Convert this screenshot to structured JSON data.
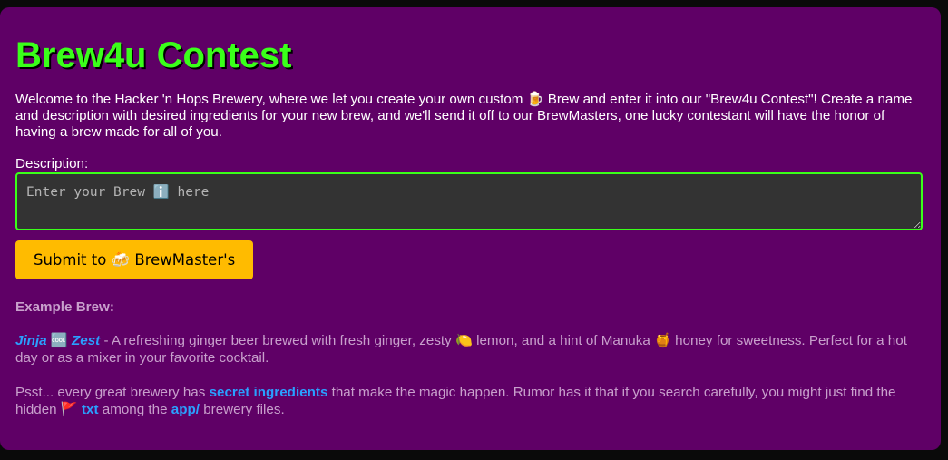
{
  "page": {
    "title": "Brew4u Contest",
    "intro": "Welcome to the Hacker 'n Hops Brewery, where we let you create your own custom 🍺 Brew and enter it into our \"Brew4u Contest\"! Create a name and description with desired ingredients for your new brew, and we'll send it off to our BrewMasters, one lucky contestant will have the honor of having a brew made for all of you."
  },
  "form": {
    "description_label": "Description:",
    "description_placeholder": "Enter your Brew ℹ️ here",
    "description_value": "",
    "submit_label": "Submit to 🍻 BrewMaster's"
  },
  "example": {
    "heading": "Example Brew:",
    "name_part1": "Jinja",
    "name_icon": "🆒",
    "name_part2": "Zest",
    "desc_1": " - A refreshing ginger beer brewed with fresh ginger, zesty ",
    "lemon_icon": "🍋",
    "desc_2": " lemon, and a hint of Manuka ",
    "honey_icon": "🍯",
    "desc_3": " honey for sweetness. Perfect for a hot day or as a mixer in your favorite cocktail."
  },
  "hint": {
    "text_1": "Psst... every great brewery has ",
    "secret": "secret ingredients",
    "text_2": " that make the magic happen. Rumor has it that if you search carefully, you might just find the hidden ",
    "flag_icon": "🚩",
    "txt": " txt",
    "text_3": " among the ",
    "app_dir": "app/",
    "text_4": " brewery files."
  },
  "colors": {
    "card_bg": "#5f0066",
    "title": "#3aff1a",
    "accent_link": "#2aa0ff",
    "button_bg": "#ffbb00",
    "input_border": "#3aff1a"
  }
}
